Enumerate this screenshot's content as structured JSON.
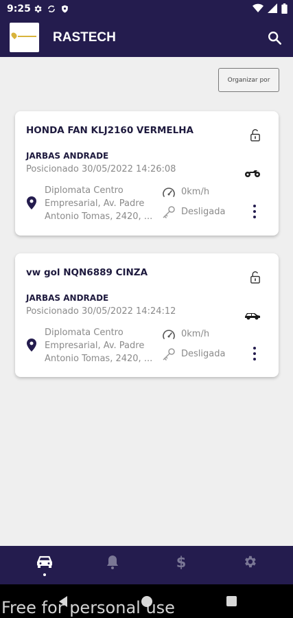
{
  "status_bar": {
    "time": "9:25",
    "left_icons": [
      "gear-icon",
      "sync-icon",
      "shield-icon"
    ],
    "right_icons": [
      "wifi-icon",
      "signal-icon",
      "battery-icon"
    ]
  },
  "app_bar": {
    "title": "RASTECH",
    "logo_icon": "rastech-logo",
    "search_icon": "search-icon"
  },
  "sort_button": {
    "label": "Organizar por"
  },
  "vehicles": [
    {
      "title": "HONDA FAN KLJ2160 VERMELHA",
      "owner": "JARBAS ANDRADE",
      "position": "Posicionado 30/05/2022 14:26:08",
      "address": "Diplomata Centro Empresarial, Av. Padre Antonio Tomas, 2420, ...",
      "speed": "0km/h",
      "ignition": "Desligada",
      "vehicle_icon": "motorcycle-icon",
      "lock_icon": "unlock-icon"
    },
    {
      "title": "vw gol NQN6889 CINZA",
      "owner": "JARBAS ANDRADE",
      "position": "Posicionado 30/05/2022 14:24:12",
      "address": "Diplomata Centro Empresarial, Av. Padre Antonio Tomas, 2420, ...",
      "speed": "0km/h",
      "ignition": "Desligada",
      "vehicle_icon": "car-icon",
      "lock_icon": "unlock-icon"
    }
  ],
  "bottom_nav": {
    "items": [
      "car-icon",
      "bell-icon",
      "dollar-icon",
      "gear-icon"
    ],
    "active": "car-icon",
    "dollar_symbol": "$"
  },
  "watermark": "Free for personal use",
  "colors": {
    "primary": "#241c4e",
    "background": "#efefef",
    "card": "#ffffff",
    "muted_text": "#8a8a8a"
  }
}
